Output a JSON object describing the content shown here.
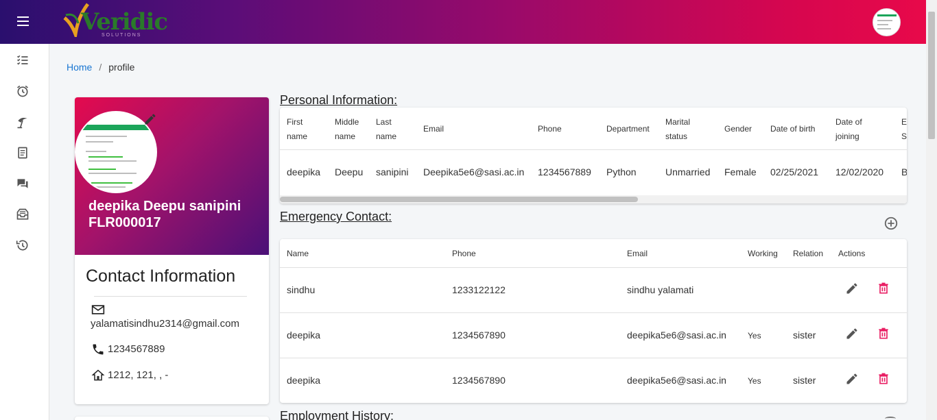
{
  "brand": {
    "logo_text": "Veridic",
    "logo_sub": "SOLUTIONS",
    "logo_color": "#2a7a2a"
  },
  "icons": {
    "menu": "menu-icon",
    "sidebar": [
      "checklist-icon",
      "alarm-icon",
      "leave-icon",
      "document-icon",
      "chat-icon",
      "inbox-icon",
      "history-icon"
    ]
  },
  "breadcrumb": {
    "home": "Home",
    "separator": "/",
    "current": "profile"
  },
  "profile": {
    "name": "deepika Deepu sanipini",
    "id": "FLR000017",
    "contact_title": "Contact Information",
    "email": "yalamatisindhu2314@gmail.com",
    "phone": "1234567889",
    "address": "1212, 121, , -"
  },
  "personal_info": {
    "title": "Personal Information:",
    "headers": [
      "First\nname",
      "Middle\nname",
      "Last\nname",
      "Email",
      "Phone",
      "Department",
      "Marital\nstatus",
      "Gender",
      "Date of birth",
      "Date of\njoining",
      "E\nS"
    ],
    "row": [
      "deepika",
      "Deepu",
      "sanipini",
      "Deepika5e6@sasi.ac.in",
      "1234567889",
      "Python",
      "Unmarried",
      "Female",
      "02/25/2021",
      "12/02/2020",
      "B"
    ]
  },
  "emergency": {
    "title": "Emergency Contact:",
    "headers": [
      "Name",
      "Phone",
      "Email",
      "Working",
      "Relation",
      "Actions"
    ],
    "rows": [
      [
        "sindhu",
        "1233122122",
        "sindhu yalamati",
        "",
        ""
      ],
      [
        "deepika",
        "1234567890",
        "deepika5e6@sasi.ac.in",
        "Yes",
        "sister"
      ],
      [
        "deepika",
        "1234567890",
        "deepika5e6@sasi.ac.in",
        "Yes",
        "sister"
      ]
    ]
  },
  "employment": {
    "title": "Employment History:"
  },
  "colors": {
    "accent": "#1976d2",
    "delete": "#e91e63",
    "gradient_start": "#2a0f6e",
    "gradient_end": "#e8094a"
  }
}
